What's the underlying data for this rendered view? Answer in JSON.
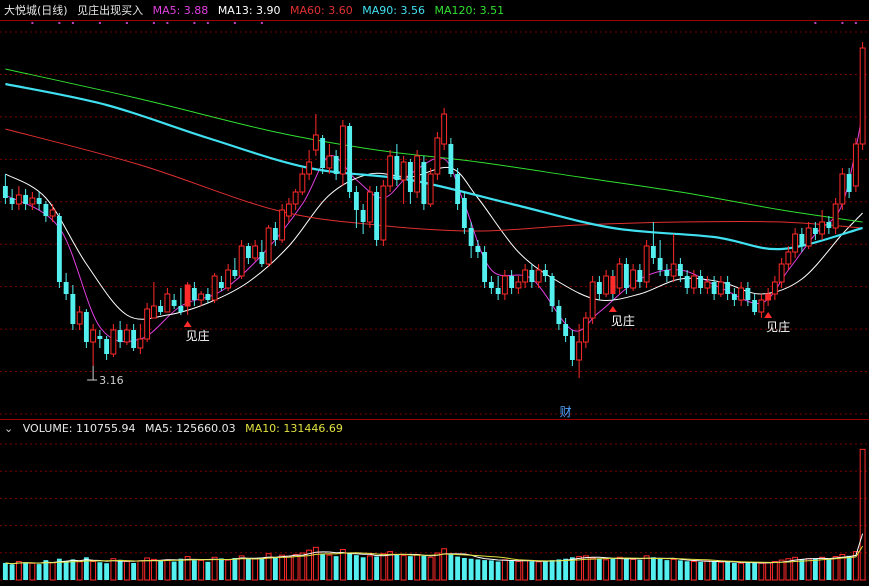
{
  "header": {
    "stock_name": "大悦城(日线)",
    "indicator_name": "见庄出现买入",
    "ma": [
      {
        "label": "MA5: 3.88",
        "color": "#e040e0"
      },
      {
        "label": "MA13: 3.90",
        "color": "#ffffff"
      },
      {
        "label": "MA60: 3.60",
        "color": "#e03030"
      },
      {
        "label": "MA90: 3.56",
        "color": "#40e0f0"
      },
      {
        "label": "MA120: 3.51",
        "color": "#30e030"
      }
    ]
  },
  "volume_header": {
    "volume": "VOLUME: 110755.94",
    "ma5": "MA5: 125660.03",
    "ma10": "MA10: 131446.69"
  },
  "chart_data": {
    "type": "candlestick",
    "x_unit": "trading day index",
    "price_ylim": [
      3.0,
      4.3
    ],
    "candles": [
      [
        3.76,
        3.72,
        3.8,
        3.7
      ],
      [
        3.72,
        3.7,
        3.75,
        3.68
      ],
      [
        3.7,
        3.73,
        3.76,
        3.68
      ],
      [
        3.73,
        3.7,
        3.75,
        3.68
      ],
      [
        3.7,
        3.72,
        3.74,
        3.68
      ],
      [
        3.72,
        3.7,
        3.74,
        3.68
      ],
      [
        3.7,
        3.66,
        3.71,
        3.64
      ],
      [
        3.66,
        3.68,
        3.7,
        3.64
      ],
      [
        3.66,
        3.44,
        3.67,
        3.42
      ],
      [
        3.44,
        3.4,
        3.47,
        3.38
      ],
      [
        3.4,
        3.3,
        3.43,
        3.28
      ],
      [
        3.3,
        3.34,
        3.36,
        3.28
      ],
      [
        3.34,
        3.24,
        3.35,
        3.22
      ],
      [
        3.24,
        3.28,
        3.3,
        3.16
      ],
      [
        3.26,
        3.25,
        3.28,
        3.22
      ],
      [
        3.25,
        3.2,
        3.26,
        3.18
      ],
      [
        3.2,
        3.28,
        3.3,
        3.19
      ],
      [
        3.28,
        3.24,
        3.31,
        3.22
      ],
      [
        3.24,
        3.28,
        3.3,
        3.23
      ],
      [
        3.28,
        3.22,
        3.3,
        3.21
      ],
      [
        3.22,
        3.25,
        3.3,
        3.2
      ],
      [
        3.25,
        3.35,
        3.37,
        3.24
      ],
      [
        3.32,
        3.36,
        3.44,
        3.33
      ],
      [
        3.36,
        3.34,
        3.38,
        3.33
      ],
      [
        3.34,
        3.4,
        3.42,
        3.34
      ],
      [
        3.38,
        3.36,
        3.4,
        3.35
      ],
      [
        3.36,
        3.34,
        3.42,
        3.33
      ],
      [
        3.36,
        3.43,
        3.44,
        3.33
      ],
      [
        3.42,
        3.38,
        3.44,
        3.36
      ],
      [
        3.38,
        3.4,
        3.41,
        3.36
      ],
      [
        3.4,
        3.38,
        3.42,
        3.37
      ],
      [
        3.38,
        3.46,
        3.47,
        3.37
      ],
      [
        3.44,
        3.42,
        3.46,
        3.41
      ],
      [
        3.42,
        3.48,
        3.5,
        3.41
      ],
      [
        3.48,
        3.46,
        3.52,
        3.45
      ],
      [
        3.46,
        3.56,
        3.58,
        3.45
      ],
      [
        3.56,
        3.52,
        3.57,
        3.5
      ],
      [
        3.52,
        3.56,
        3.58,
        3.51
      ],
      [
        3.54,
        3.5,
        3.58,
        3.49
      ],
      [
        3.5,
        3.62,
        3.63,
        3.49
      ],
      [
        3.62,
        3.58,
        3.64,
        3.56
      ],
      [
        3.58,
        3.68,
        3.7,
        3.57
      ],
      [
        3.66,
        3.7,
        3.72,
        3.64
      ],
      [
        3.7,
        3.74,
        3.75,
        3.68
      ],
      [
        3.74,
        3.8,
        3.82,
        3.73
      ],
      [
        3.8,
        3.84,
        3.88,
        3.78
      ],
      [
        3.88,
        3.93,
        4.0,
        3.86
      ],
      [
        3.92,
        3.82,
        3.93,
        3.8
      ],
      [
        3.82,
        3.86,
        3.9,
        3.8
      ],
      [
        3.86,
        3.8,
        3.88,
        3.78
      ],
      [
        3.8,
        3.96,
        3.98,
        3.76
      ],
      [
        3.96,
        3.74,
        3.97,
        3.72
      ],
      [
        3.74,
        3.68,
        3.76,
        3.62
      ],
      [
        3.68,
        3.64,
        3.7,
        3.6
      ],
      [
        3.64,
        3.74,
        3.76,
        3.62
      ],
      [
        3.74,
        3.58,
        3.76,
        3.56
      ],
      [
        3.58,
        3.76,
        3.78,
        3.56
      ],
      [
        3.76,
        3.86,
        3.88,
        3.74
      ],
      [
        3.86,
        3.78,
        3.9,
        3.76
      ],
      [
        3.78,
        3.84,
        3.86,
        3.7
      ],
      [
        3.84,
        3.74,
        3.85,
        3.7
      ],
      [
        3.74,
        3.86,
        3.88,
        3.72
      ],
      [
        3.84,
        3.7,
        3.86,
        3.68
      ],
      [
        3.7,
        3.8,
        3.82,
        3.69
      ],
      [
        3.8,
        3.92,
        3.94,
        3.78
      ],
      [
        3.9,
        4.0,
        4.02,
        3.88
      ],
      [
        3.9,
        3.8,
        3.92,
        3.79
      ],
      [
        3.8,
        3.7,
        3.82,
        3.68
      ],
      [
        3.72,
        3.62,
        3.74,
        3.6
      ],
      [
        3.62,
        3.56,
        3.64,
        3.52
      ],
      [
        3.56,
        3.54,
        3.58,
        3.52
      ],
      [
        3.54,
        3.44,
        3.56,
        3.42
      ],
      [
        3.44,
        3.42,
        3.46,
        3.4
      ],
      [
        3.42,
        3.4,
        3.46,
        3.38
      ],
      [
        3.4,
        3.46,
        3.48,
        3.38
      ],
      [
        3.46,
        3.42,
        3.48,
        3.4
      ],
      [
        3.42,
        3.44,
        3.46,
        3.4
      ],
      [
        3.44,
        3.48,
        3.5,
        3.42
      ],
      [
        3.48,
        3.44,
        3.5,
        3.42
      ],
      [
        3.44,
        3.48,
        3.5,
        3.42
      ],
      [
        3.48,
        3.46,
        3.5,
        3.44
      ],
      [
        3.46,
        3.36,
        3.47,
        3.34
      ],
      [
        3.36,
        3.3,
        3.38,
        3.28
      ],
      [
        3.3,
        3.26,
        3.32,
        3.24
      ],
      [
        3.26,
        3.18,
        3.28,
        3.16
      ],
      [
        3.18,
        3.24,
        3.3,
        3.12
      ],
      [
        3.24,
        3.32,
        3.34,
        3.22
      ],
      [
        3.32,
        3.44,
        3.46,
        3.3
      ],
      [
        3.44,
        3.4,
        3.46,
        3.38
      ],
      [
        3.4,
        3.46,
        3.48,
        3.39
      ],
      [
        3.46,
        3.4,
        3.48,
        3.38
      ],
      [
        3.42,
        3.5,
        3.52,
        3.4
      ],
      [
        3.5,
        3.42,
        3.52,
        3.4
      ],
      [
        3.42,
        3.48,
        3.5,
        3.41
      ],
      [
        3.48,
        3.44,
        3.5,
        3.42
      ],
      [
        3.44,
        3.56,
        3.58,
        3.42
      ],
      [
        3.56,
        3.52,
        3.64,
        3.5
      ],
      [
        3.52,
        3.48,
        3.58,
        3.46
      ],
      [
        3.48,
        3.46,
        3.5,
        3.44
      ],
      [
        3.46,
        3.5,
        3.6,
        3.44
      ],
      [
        3.5,
        3.46,
        3.52,
        3.44
      ],
      [
        3.46,
        3.42,
        3.48,
        3.4
      ],
      [
        3.42,
        3.46,
        3.48,
        3.4
      ],
      [
        3.46,
        3.42,
        3.48,
        3.4
      ],
      [
        3.42,
        3.44,
        3.46,
        3.4
      ],
      [
        3.44,
        3.4,
        3.46,
        3.38
      ],
      [
        3.4,
        3.44,
        3.46,
        3.39
      ],
      [
        3.44,
        3.4,
        3.46,
        3.38
      ],
      [
        3.4,
        3.38,
        3.42,
        3.36
      ],
      [
        3.38,
        3.42,
        3.44,
        3.36
      ],
      [
        3.42,
        3.38,
        3.44,
        3.36
      ],
      [
        3.38,
        3.34,
        3.4,
        3.33
      ],
      [
        3.34,
        3.38,
        3.4,
        3.32
      ],
      [
        3.38,
        3.4,
        3.42,
        3.36
      ],
      [
        3.4,
        3.44,
        3.46,
        3.38
      ],
      [
        3.44,
        3.5,
        3.52,
        3.42
      ],
      [
        3.5,
        3.54,
        3.56,
        3.48
      ],
      [
        3.54,
        3.6,
        3.62,
        3.52
      ],
      [
        3.6,
        3.56,
        3.62,
        3.54
      ],
      [
        3.56,
        3.62,
        3.64,
        3.55
      ],
      [
        3.62,
        3.6,
        3.64,
        3.58
      ],
      [
        3.6,
        3.64,
        3.68,
        3.58
      ],
      [
        3.64,
        3.62,
        3.66,
        3.6
      ],
      [
        3.62,
        3.7,
        3.72,
        3.6
      ],
      [
        3.7,
        3.8,
        3.82,
        3.68
      ],
      [
        3.8,
        3.74,
        3.82,
        3.72
      ],
      [
        3.76,
        3.9,
        3.92,
        3.74
      ],
      [
        3.9,
        4.22,
        4.24,
        3.88
      ]
    ],
    "series": [
      {
        "name": "MA5",
        "color": "#e040e0",
        "values": [
          [
            0,
            3.73
          ],
          [
            8,
            3.62
          ],
          [
            14,
            3.29
          ],
          [
            20,
            3.25
          ],
          [
            26,
            3.36
          ],
          [
            32,
            3.41
          ],
          [
            38,
            3.53
          ],
          [
            44,
            3.7
          ],
          [
            48,
            3.86
          ],
          [
            52,
            3.78
          ],
          [
            56,
            3.72
          ],
          [
            60,
            3.8
          ],
          [
            65,
            3.85
          ],
          [
            68,
            3.7
          ],
          [
            72,
            3.48
          ],
          [
            78,
            3.45
          ],
          [
            84,
            3.28
          ],
          [
            88,
            3.34
          ],
          [
            94,
            3.45
          ],
          [
            100,
            3.48
          ],
          [
            106,
            3.42
          ],
          [
            112,
            3.37
          ],
          [
            116,
            3.48
          ],
          [
            120,
            3.6
          ],
          [
            124,
            3.7
          ],
          [
            127,
            4.0
          ]
        ]
      },
      {
        "name": "MA13",
        "color": "#ffffff",
        "values": [
          [
            0,
            3.8
          ],
          [
            6,
            3.72
          ],
          [
            12,
            3.5
          ],
          [
            18,
            3.33
          ],
          [
            24,
            3.33
          ],
          [
            30,
            3.37
          ],
          [
            36,
            3.44
          ],
          [
            42,
            3.56
          ],
          [
            48,
            3.73
          ],
          [
            54,
            3.8
          ],
          [
            60,
            3.79
          ],
          [
            66,
            3.82
          ],
          [
            70,
            3.72
          ],
          [
            76,
            3.54
          ],
          [
            82,
            3.44
          ],
          [
            88,
            3.38
          ],
          [
            94,
            3.4
          ],
          [
            100,
            3.45
          ],
          [
            106,
            3.44
          ],
          [
            112,
            3.4
          ],
          [
            118,
            3.45
          ],
          [
            124,
            3.6
          ],
          [
            127,
            3.67
          ]
        ]
      },
      {
        "name": "MA60",
        "color": "#e03030",
        "values": [
          [
            0,
            3.95
          ],
          [
            20,
            3.83
          ],
          [
            40,
            3.68
          ],
          [
            55,
            3.63
          ],
          [
            70,
            3.61
          ],
          [
            85,
            3.63
          ],
          [
            100,
            3.64
          ],
          [
            115,
            3.64
          ],
          [
            127,
            3.62
          ]
        ]
      },
      {
        "name": "MA90",
        "color": "#40e0f0",
        "values": [
          [
            0,
            4.1
          ],
          [
            15,
            4.03
          ],
          [
            30,
            3.92
          ],
          [
            45,
            3.82
          ],
          [
            60,
            3.78
          ],
          [
            75,
            3.7
          ],
          [
            90,
            3.62
          ],
          [
            105,
            3.59
          ],
          [
            115,
            3.55
          ],
          [
            127,
            3.62
          ]
        ]
      },
      {
        "name": "MA120",
        "color": "#30e030",
        "values": [
          [
            0,
            4.15
          ],
          [
            20,
            4.05
          ],
          [
            40,
            3.94
          ],
          [
            55,
            3.88
          ],
          [
            70,
            3.84
          ],
          [
            85,
            3.79
          ],
          [
            100,
            3.74
          ],
          [
            115,
            3.68
          ],
          [
            127,
            3.64
          ]
        ]
      }
    ],
    "signals": [
      {
        "index": 27,
        "label": "见庄"
      },
      {
        "index": 90,
        "label": "见庄"
      },
      {
        "index": 113,
        "label": "见庄"
      }
    ],
    "low_annotation": {
      "index": 13,
      "value": 3.16,
      "label": "3.16"
    },
    "marker_label": {
      "index": 83,
      "label": "财"
    },
    "volume_ylim": [
      0,
      1000000
    ],
    "volume": [
      120000,
      110000,
      130000,
      125000,
      118000,
      112000,
      140000,
      122000,
      150000,
      135000,
      145000,
      128000,
      160000,
      130000,
      125000,
      118000,
      150000,
      142000,
      130000,
      120000,
      135000,
      155000,
      145000,
      138000,
      142000,
      130000,
      150000,
      165000,
      140000,
      138000,
      128000,
      160000,
      152000,
      140000,
      155000,
      170000,
      150000,
      148000,
      155000,
      185000,
      160000,
      175000,
      168000,
      180000,
      190000,
      210000,
      230000,
      180000,
      175000,
      168000,
      215000,
      190000,
      175000,
      160000,
      170000,
      165000,
      185000,
      200000,
      178000,
      172000,
      168000,
      180000,
      170000,
      160000,
      190000,
      220000,
      185000,
      165000,
      155000,
      150000,
      145000,
      140000,
      138000,
      130000,
      142000,
      135000,
      130000,
      138000,
      132000,
      128000,
      130000,
      140000,
      145000,
      150000,
      160000,
      165000,
      170000,
      155000,
      148000,
      142000,
      150000,
      160000,
      148000,
      145000,
      142000,
      170000,
      160000,
      150000,
      140000,
      145000,
      138000,
      132000,
      130000,
      128000,
      135000,
      130000,
      125000,
      128000,
      120000,
      118000,
      125000,
      120000,
      118000,
      122000,
      130000,
      140000,
      150000,
      160000,
      145000,
      150000,
      148000,
      160000,
      150000,
      165000,
      180000,
      170000,
      200000,
      920000
    ],
    "volume_series": [
      {
        "name": "MA5",
        "color": "#ffffff"
      },
      {
        "name": "MA10",
        "color": "#e0e040"
      }
    ]
  }
}
